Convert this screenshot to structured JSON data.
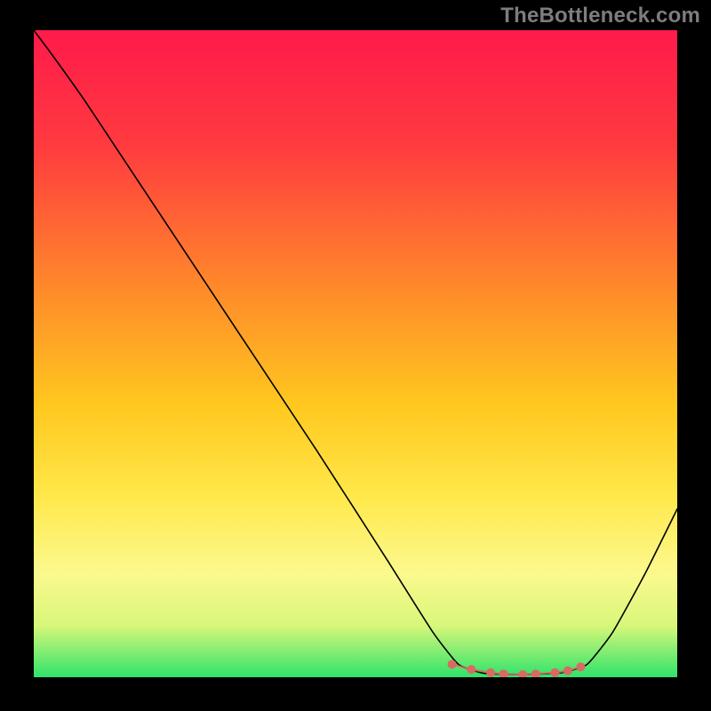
{
  "watermark": "TheBottleneck.com",
  "chart_data": {
    "type": "line",
    "title": "",
    "xlabel": "",
    "ylabel": "",
    "xlim": [
      0,
      100
    ],
    "ylim": [
      0,
      100
    ],
    "background_gradient": {
      "stops": [
        {
          "offset": 0,
          "color": "#ff1a4b"
        },
        {
          "offset": 18,
          "color": "#ff3b3f"
        },
        {
          "offset": 40,
          "color": "#ff8a2a"
        },
        {
          "offset": 58,
          "color": "#ffc81f"
        },
        {
          "offset": 72,
          "color": "#ffe84a"
        },
        {
          "offset": 84,
          "color": "#fbf98e"
        },
        {
          "offset": 92,
          "color": "#d8f77a"
        },
        {
          "offset": 100,
          "color": "#2fe36a"
        }
      ]
    },
    "series": [
      {
        "name": "bottleneck-curve",
        "color": "#000000",
        "width": 1.6,
        "points": [
          {
            "x": 0,
            "y": 100
          },
          {
            "x": 3,
            "y": 96
          },
          {
            "x": 8,
            "y": 89
          },
          {
            "x": 14,
            "y": 80
          },
          {
            "x": 22,
            "y": 68
          },
          {
            "x": 32,
            "y": 53
          },
          {
            "x": 44,
            "y": 35
          },
          {
            "x": 55,
            "y": 18
          },
          {
            "x": 62,
            "y": 7
          },
          {
            "x": 66,
            "y": 2
          },
          {
            "x": 70,
            "y": 0.6
          },
          {
            "x": 76,
            "y": 0.4
          },
          {
            "x": 82,
            "y": 0.7
          },
          {
            "x": 86,
            "y": 2
          },
          {
            "x": 90,
            "y": 7
          },
          {
            "x": 95,
            "y": 16
          },
          {
            "x": 100,
            "y": 26
          }
        ]
      },
      {
        "name": "bottom-markers",
        "color": "#d96a63",
        "marker_radius": 5,
        "points": [
          {
            "x": 65,
            "y": 2.0
          },
          {
            "x": 68,
            "y": 1.2
          },
          {
            "x": 71,
            "y": 0.7
          },
          {
            "x": 73,
            "y": 0.5
          },
          {
            "x": 76,
            "y": 0.4
          },
          {
            "x": 78,
            "y": 0.5
          },
          {
            "x": 81,
            "y": 0.7
          },
          {
            "x": 83,
            "y": 1.0
          },
          {
            "x": 85,
            "y": 1.6
          }
        ]
      }
    ]
  }
}
